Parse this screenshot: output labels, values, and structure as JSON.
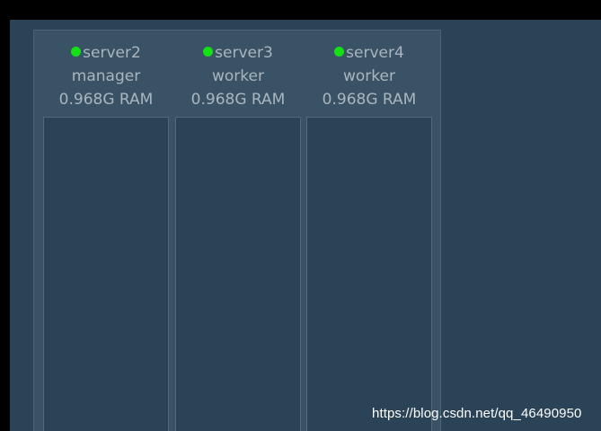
{
  "nodes": [
    {
      "name": "server2",
      "role": "manager",
      "ram": "0.968G RAM",
      "status_color": "#14e014"
    },
    {
      "name": "server3",
      "role": "worker",
      "ram": "0.968G RAM",
      "status_color": "#14e014"
    },
    {
      "name": "server4",
      "role": "worker",
      "ram": "0.968G RAM",
      "status_color": "#14e014"
    }
  ],
  "watermark": "https://blog.csdn.net/qq_46490950",
  "colors": {
    "background": "#2a4356",
    "panel": "#3a5266",
    "text": "#a9b6bf",
    "status_up": "#14e014"
  }
}
